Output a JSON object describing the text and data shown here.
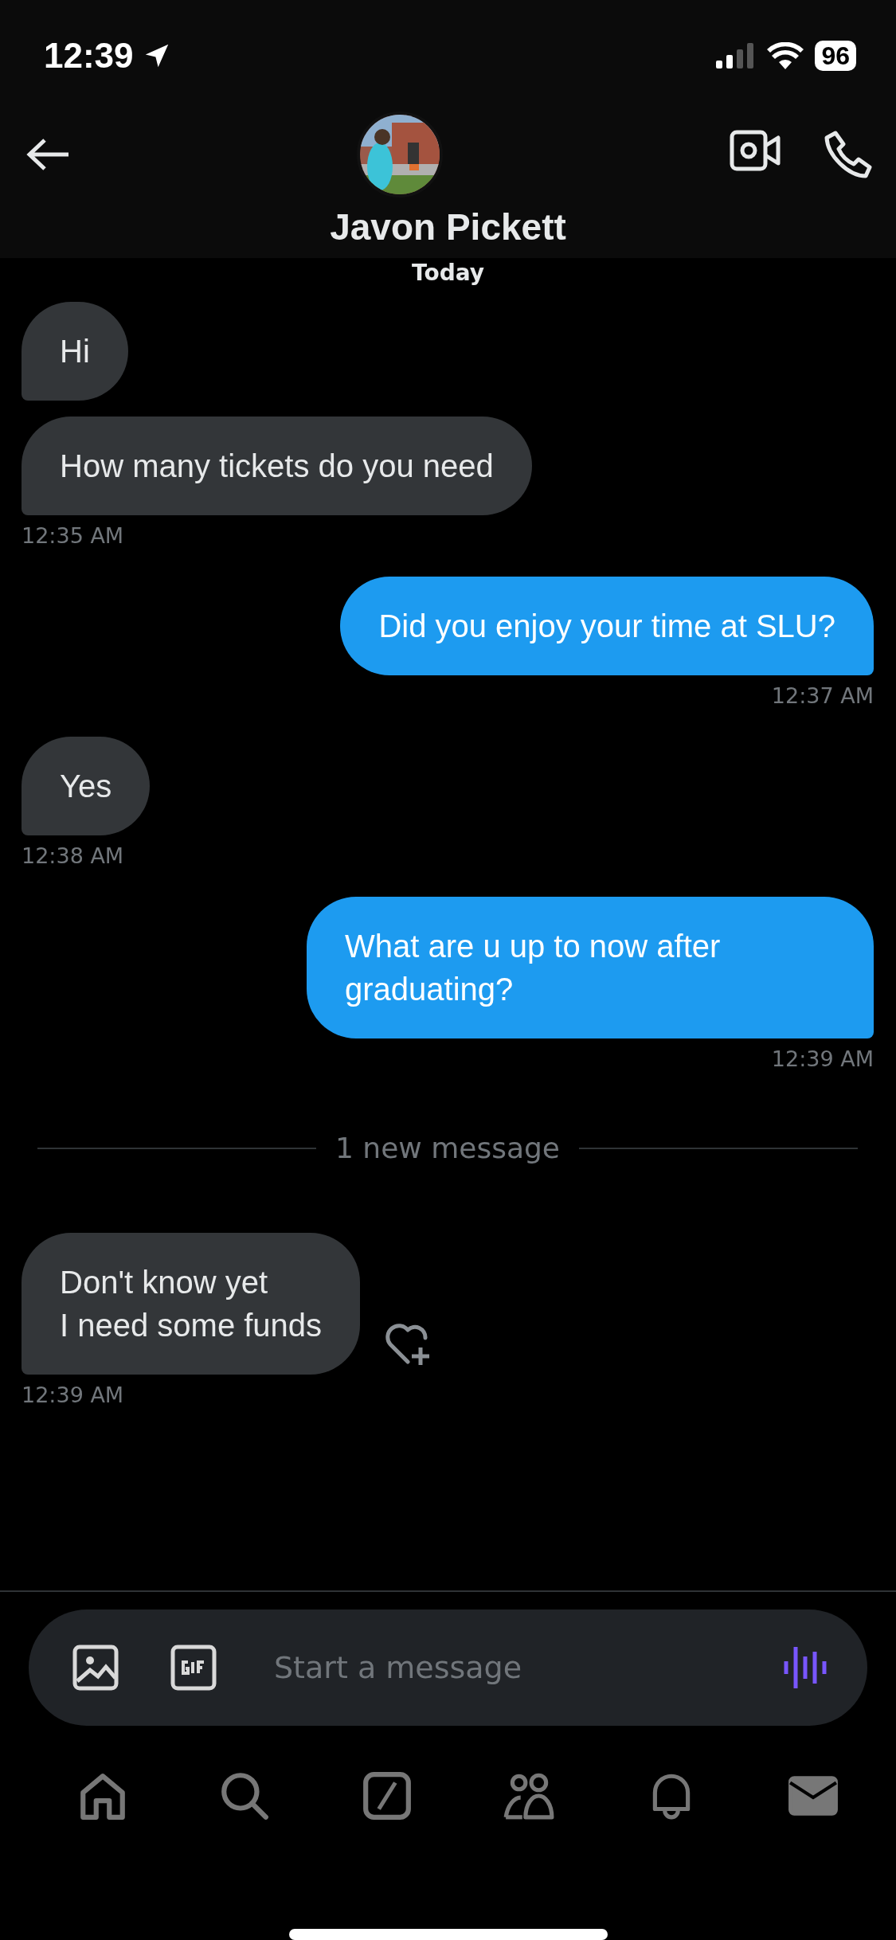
{
  "status_bar": {
    "time": "12:39",
    "battery": "96"
  },
  "header": {
    "name": "Javon Pickett"
  },
  "day_label": "Today",
  "messages": [
    {
      "kind": "received",
      "text": "Hi"
    },
    {
      "kind": "received",
      "text": "How many tickets do you need",
      "time": "12:35 AM"
    },
    {
      "kind": "sent",
      "text": "Did you enjoy your time at SLU?",
      "time": "12:37 AM"
    },
    {
      "kind": "received",
      "text": "Yes",
      "time": "12:38 AM"
    },
    {
      "kind": "sent",
      "text": "What are u up to now after graduating?",
      "time": "12:39 AM"
    },
    {
      "kind": "divider",
      "text": "1 new message"
    },
    {
      "kind": "received",
      "text": "Don't know yet\nI need some funds",
      "time": "12:39 AM",
      "react": true
    }
  ],
  "composer": {
    "placeholder": "Start a message"
  },
  "tabs": [
    {
      "kind": "home",
      "selected": false
    },
    {
      "kind": "search",
      "selected": false
    },
    {
      "kind": "grok",
      "selected": false
    },
    {
      "kind": "communities",
      "selected": false
    },
    {
      "kind": "notifications",
      "selected": false
    },
    {
      "kind": "messages",
      "selected": true
    }
  ]
}
